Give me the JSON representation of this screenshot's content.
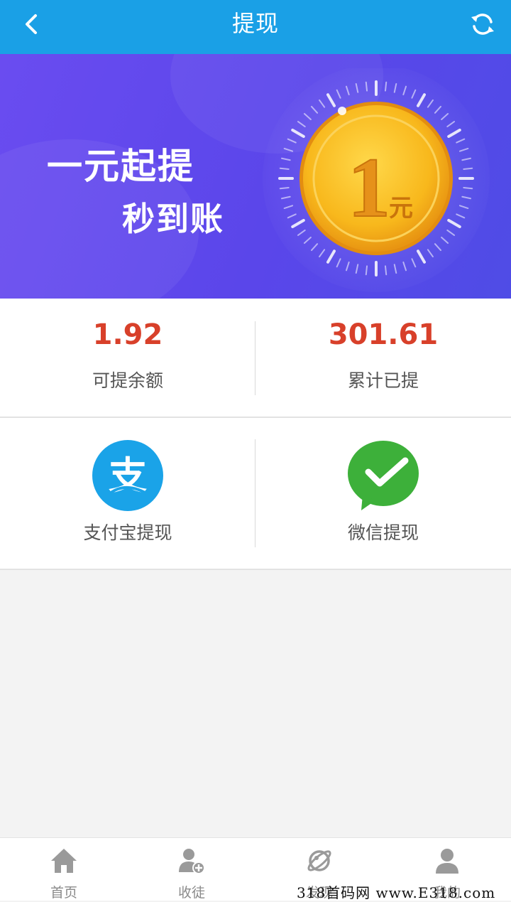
{
  "header": {
    "title": "提现",
    "back_icon": "chevron-left-icon",
    "refresh_icon": "refresh-icon",
    "bg_color": "#1aa0e6"
  },
  "banner": {
    "slogan_line1": "一元起提",
    "slogan_line2": "秒到账",
    "coin_number": "1",
    "coin_unit": "元"
  },
  "stats": {
    "available": {
      "value": "1.92",
      "label": "可提余额"
    },
    "withdrawn_total": {
      "value": "301.61",
      "label": "累计已提"
    },
    "value_color": "#d8402a"
  },
  "methods": [
    {
      "label": "支付宝提现",
      "icon": "alipay-icon",
      "glyph": "支",
      "color": "#1aa3e8"
    },
    {
      "label": "微信提现",
      "icon": "wechat-icon",
      "color": "#3db03a"
    }
  ],
  "tabbar": {
    "items": [
      {
        "label": "首页",
        "icon": "home-icon"
      },
      {
        "label": "收徒",
        "icon": "add-user-icon"
      },
      {
        "label": "发现",
        "icon": "planet-icon"
      },
      {
        "label": "我的",
        "icon": "user-icon"
      }
    ]
  },
  "watermark": "318首码网 www.E318.com"
}
